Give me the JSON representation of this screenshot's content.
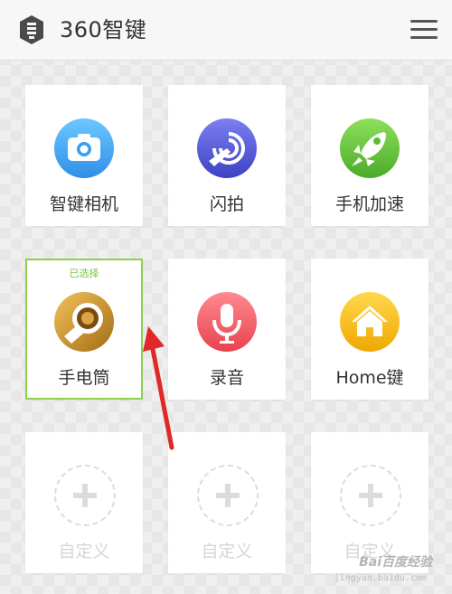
{
  "header": {
    "title": "360智键",
    "logo_icon": "key-logo-icon",
    "menu_icon": "hamburger-menu-icon"
  },
  "tiles": [
    {
      "label": "智键相机",
      "icon": "camera-icon",
      "color": "#3fa9f5"
    },
    {
      "label": "闪拍",
      "icon": "touch-tap-icon",
      "color": "#5a5fd6"
    },
    {
      "label": "手机加速",
      "icon": "rocket-icon",
      "color": "#6cc644"
    },
    {
      "label": "手电筒",
      "icon": "flashlight-icon",
      "color": "#c8962a",
      "selected": true,
      "badge": "已选择"
    },
    {
      "label": "录音",
      "icon": "microphone-icon",
      "color": "#f05a67"
    },
    {
      "label": "Home键",
      "icon": "home-icon",
      "color": "#f5b400"
    },
    {
      "label": "自定义",
      "icon": "plus-icon",
      "empty": true
    },
    {
      "label": "自定义",
      "icon": "plus-icon",
      "empty": true
    },
    {
      "label": "自定义",
      "icon": "plus-icon",
      "empty": true
    }
  ],
  "annotation": {
    "arrow_color": "#e02828"
  },
  "watermark": {
    "text": "Bai百度经验",
    "sub": "jingyan.baidu.com"
  }
}
